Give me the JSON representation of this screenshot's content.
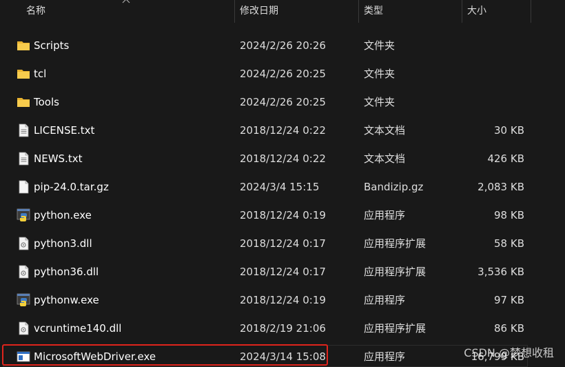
{
  "columns": {
    "name": "名称",
    "modified": "修改日期",
    "type": "类型",
    "size": "大小"
  },
  "files": [
    {
      "name": "Scripts",
      "modified": "2024/2/26 20:26",
      "type": "文件夹",
      "size": "",
      "icon": "folder-icon"
    },
    {
      "name": "tcl",
      "modified": "2024/2/26 20:25",
      "type": "文件夹",
      "size": "",
      "icon": "folder-icon"
    },
    {
      "name": "Tools",
      "modified": "2024/2/26 20:25",
      "type": "文件夹",
      "size": "",
      "icon": "folder-icon"
    },
    {
      "name": "LICENSE.txt",
      "modified": "2018/12/24 0:22",
      "type": "文本文档",
      "size": "30 KB",
      "icon": "text-file-icon"
    },
    {
      "name": "NEWS.txt",
      "modified": "2018/12/24 0:22",
      "type": "文本文档",
      "size": "426 KB",
      "icon": "text-file-icon"
    },
    {
      "name": "pip-24.0.tar.gz",
      "modified": "2024/3/4 15:15",
      "type": "Bandizip.gz",
      "size": "2,083 KB",
      "icon": "blank-file-icon"
    },
    {
      "name": "python.exe",
      "modified": "2018/12/24 0:19",
      "type": "应用程序",
      "size": "98 KB",
      "icon": "python-exe-icon"
    },
    {
      "name": "python3.dll",
      "modified": "2018/12/24 0:17",
      "type": "应用程序扩展",
      "size": "58 KB",
      "icon": "dll-file-icon"
    },
    {
      "name": "python36.dll",
      "modified": "2018/12/24 0:17",
      "type": "应用程序扩展",
      "size": "3,536 KB",
      "icon": "dll-file-icon"
    },
    {
      "name": "pythonw.exe",
      "modified": "2018/12/24 0:19",
      "type": "应用程序",
      "size": "97 KB",
      "icon": "python-exe-icon"
    },
    {
      "name": "vcruntime140.dll",
      "modified": "2018/2/19 21:06",
      "type": "应用程序扩展",
      "size": "86 KB",
      "icon": "dll-file-icon"
    },
    {
      "name": "MicrosoftWebDriver.exe",
      "modified": "2024/3/14 15:08",
      "type": "应用程序",
      "size": "16,799 KB",
      "icon": "window-exe-icon"
    }
  ],
  "watermark": "CSDN @梦想收租",
  "colors": {
    "background": "#191919",
    "highlight_border": "#e0241c",
    "folder": "#f5c842",
    "text": "#ffffff"
  }
}
